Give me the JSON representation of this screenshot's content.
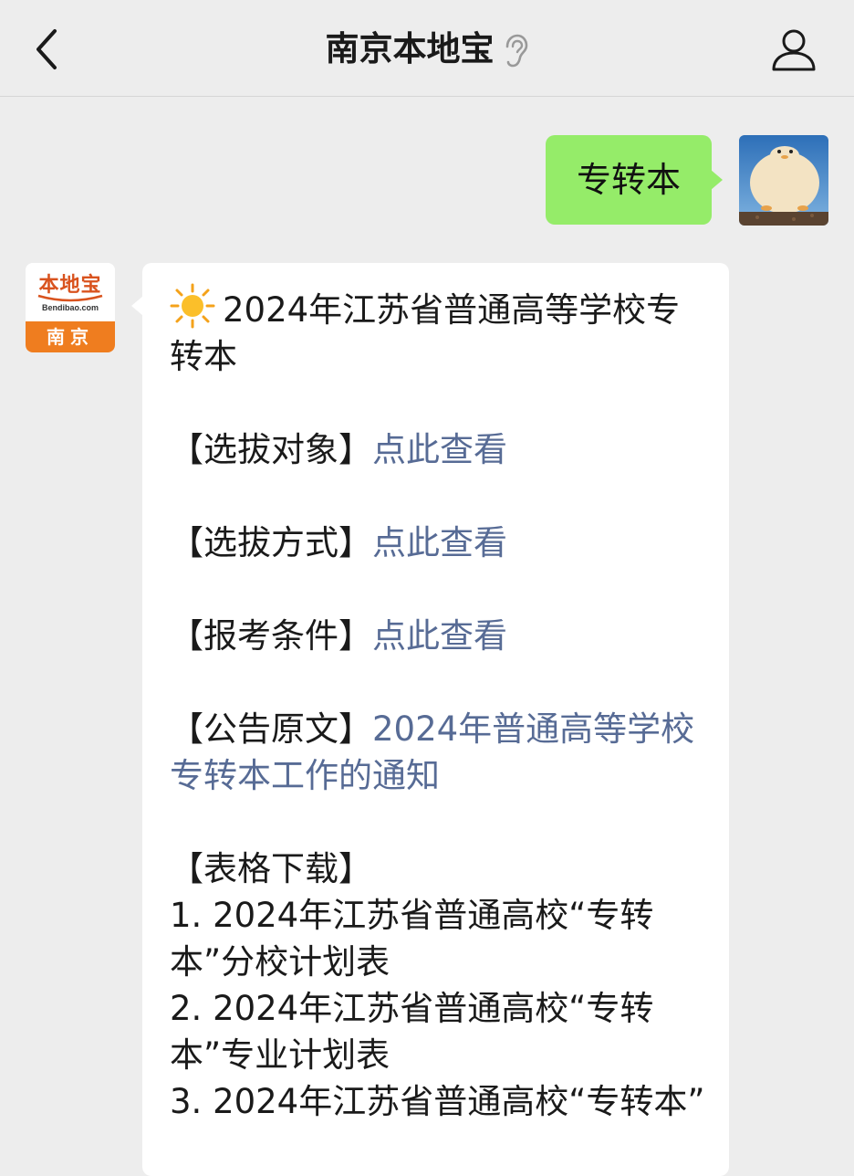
{
  "header": {
    "title": "南京本地宝"
  },
  "chat": {
    "user_message": "专转本",
    "bot_logo": {
      "name": "本地宝",
      "url": "Bendibao.com",
      "city": "南京"
    },
    "reply": {
      "title": "2024年江苏省普通高等学校专转本",
      "rows": [
        {
          "label": "【选拔对象】",
          "link": "点此查看"
        },
        {
          "label": "【选拔方式】",
          "link": "点此查看"
        },
        {
          "label": "【报考条件】",
          "link": "点此查看"
        },
        {
          "label": "【公告原文】",
          "link": "2024年普通高等学校专转本工作的通知"
        }
      ],
      "downloads_label": "【表格下载】",
      "downloads": [
        "1. 2024年江苏省普通高校“专转本”分校计划表",
        "2. 2024年江苏省普通高校“专转本”专业计划表",
        "3. 2024年江苏省普通高校“专转本”"
      ]
    }
  },
  "colors": {
    "background": "#ededed",
    "user_bubble": "#95ec69",
    "link": "#576b95",
    "brand_orange": "#ef7d1f"
  }
}
